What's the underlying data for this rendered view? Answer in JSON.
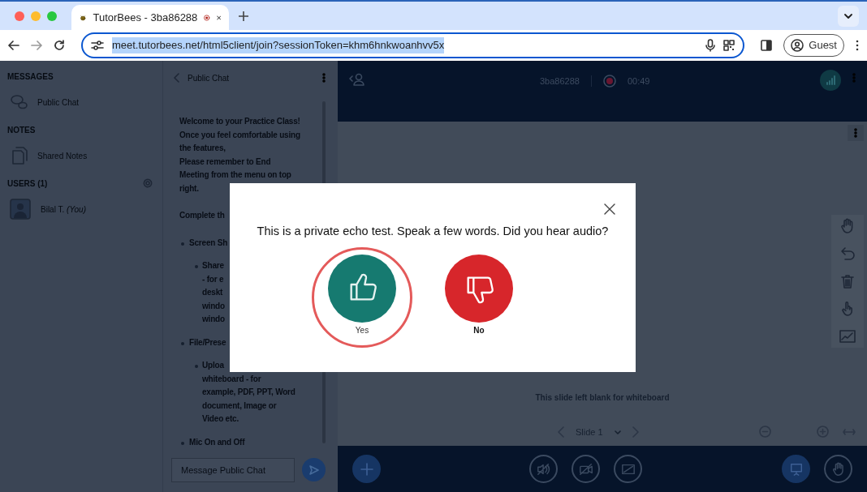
{
  "browser": {
    "tab": {
      "title": "TutorBees - 3ba86288",
      "recording": true
    },
    "url": "meet.tutorbees.net/html5client/join?sessionToken=khm6hnkwoanhvv5x",
    "url_selected": true,
    "profile": "Guest"
  },
  "sidebar": {
    "sections": [
      {
        "title": "MESSAGES",
        "items": [
          {
            "kind": "chat",
            "label": "Public Chat"
          }
        ]
      },
      {
        "title": "NOTES",
        "items": [
          {
            "kind": "notes",
            "label": "Shared Notes"
          }
        ]
      },
      {
        "title": "USERS (1)",
        "items": [
          {
            "kind": "user",
            "label": "Bilal T. *(You)*"
          }
        ]
      }
    ]
  },
  "chat": {
    "title": "Public Chat",
    "blocks": [
      {
        "kind": "para",
        "lines": [
          "**Welcome to your Practice Class!**",
          "**Once you feel comfortable using**",
          "**the features,**",
          "Please remember to **End**",
          "**Meeting** from the menu on top",
          "right."
        ]
      },
      {
        "kind": "para",
        "lines": [
          "**Complete th**"
        ]
      },
      {
        "kind": "bullet",
        "lines": [
          "Screen Sh"
        ]
      },
      {
        "kind": "subbullet",
        "lines": [
          "Share",
          "- for e",
          "deskt",
          "windo",
          "windo"
        ]
      },
      {
        "kind": "bullet",
        "lines": [
          "File/Prese"
        ]
      },
      {
        "kind": "subbullet",
        "lines": [
          "Uploa",
          "whiteboard - for",
          "example, PDF, PPT, Word",
          "document, Image or",
          "Video etc."
        ]
      },
      {
        "kind": "bullet",
        "lines": [
          "Mic On and Off"
        ]
      }
    ],
    "input": {
      "placeholder": "Message Public Chat"
    }
  },
  "meeting": {
    "name": "3ba86288",
    "recording": true,
    "time": "00:49"
  },
  "whiteboard": {
    "slide_text": "This slide left blank for whiteboard",
    "slide": "Slide 1"
  },
  "modal": {
    "message": "This is a private echo test. Speak a few words. Did you hear audio?",
    "answers": [
      {
        "kind": "yes",
        "label": "Yes",
        "selected": true
      },
      {
        "kind": "no",
        "label": "No",
        "selected": false
      }
    ]
  }
}
